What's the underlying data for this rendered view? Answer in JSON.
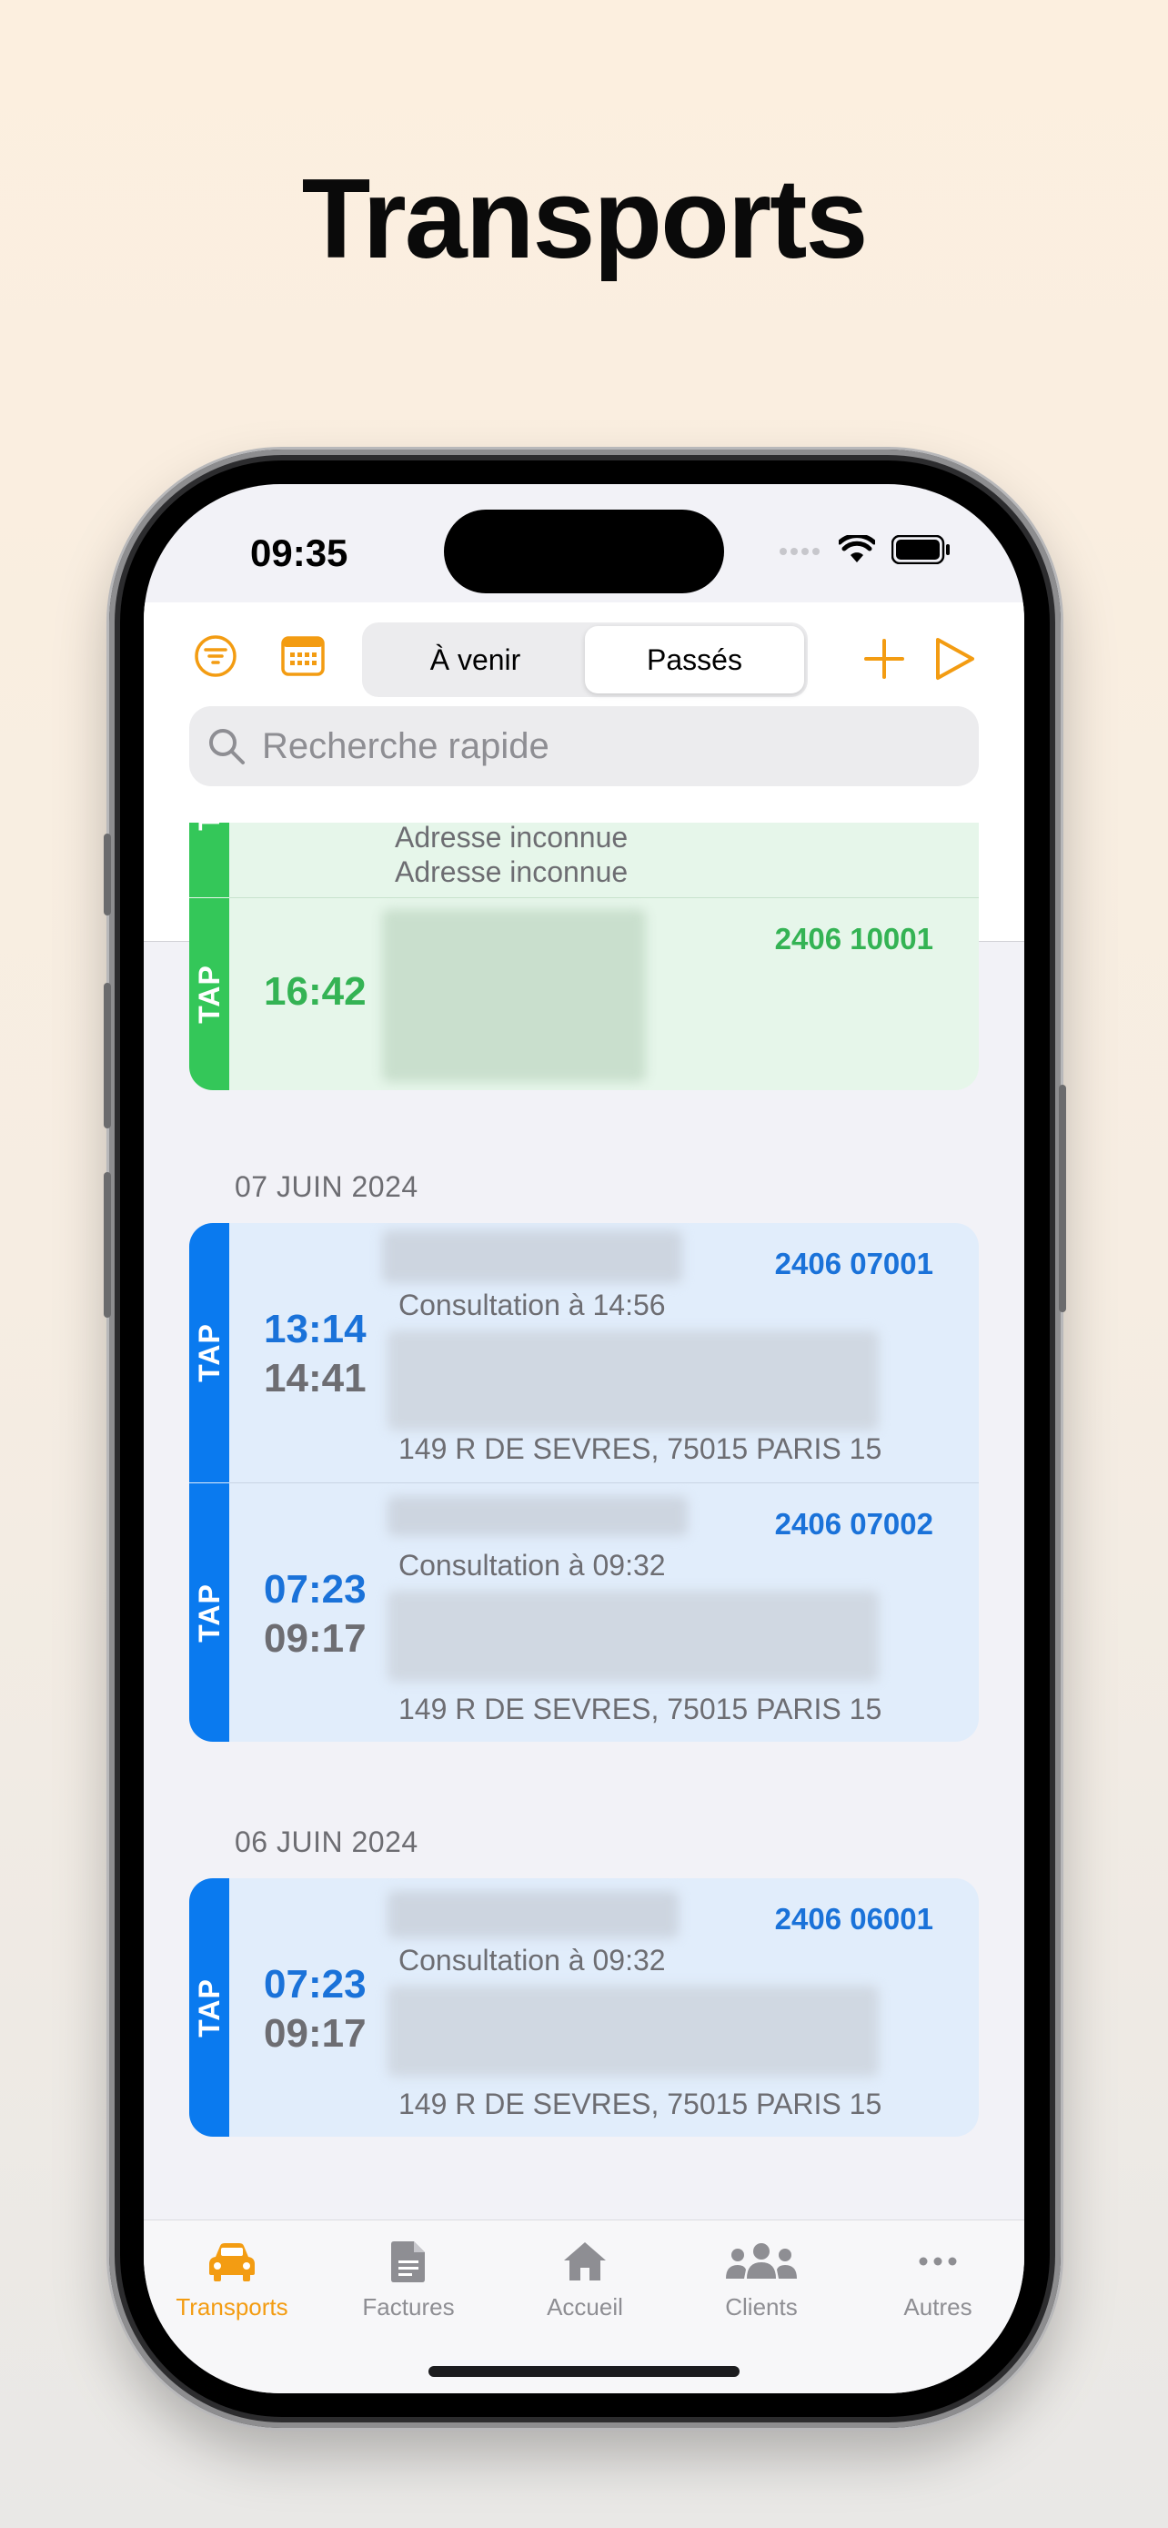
{
  "headline": "Transports",
  "status": {
    "time": "09:35"
  },
  "toolbar": {
    "segments": [
      "À venir",
      "Passés"
    ],
    "active_segment": "Passés",
    "accent": "#f39c12"
  },
  "search": {
    "placeholder": "Recherche rapide"
  },
  "partial_card": {
    "address1": "Adresse inconnue",
    "address2": "Adresse inconnue",
    "tag": "TAP",
    "time": "16:42",
    "ref": "2406 10001"
  },
  "sections": [
    {
      "date": "07 JUIN 2024",
      "rows": [
        {
          "tag": "TAP",
          "time_start": "13:14",
          "time_end": "14:41",
          "ref": "2406 07001",
          "note": "Consultation à 14:56",
          "address": "149 R DE SEVRES, 75015 PARIS 15"
        },
        {
          "tag": "TAP",
          "time_start": "07:23",
          "time_end": "09:17",
          "ref": "2406 07002",
          "note": "Consultation à 09:32",
          "address": "149 R DE SEVRES, 75015 PARIS 15"
        }
      ]
    },
    {
      "date": "06 JUIN 2024",
      "rows": [
        {
          "tag": "TAP",
          "time_start": "07:23",
          "time_end": "09:17",
          "ref": "2406 06001",
          "note": "Consultation à 09:32",
          "address": "149 R DE SEVRES, 75015 PARIS 15"
        }
      ]
    }
  ],
  "tabbar": {
    "items": [
      "Transports",
      "Factures",
      "Accueil",
      "Clients",
      "Autres"
    ],
    "active": "Transports",
    "icons": [
      "car-icon",
      "document-icon",
      "house-icon",
      "people-icon",
      "more-icon"
    ]
  }
}
